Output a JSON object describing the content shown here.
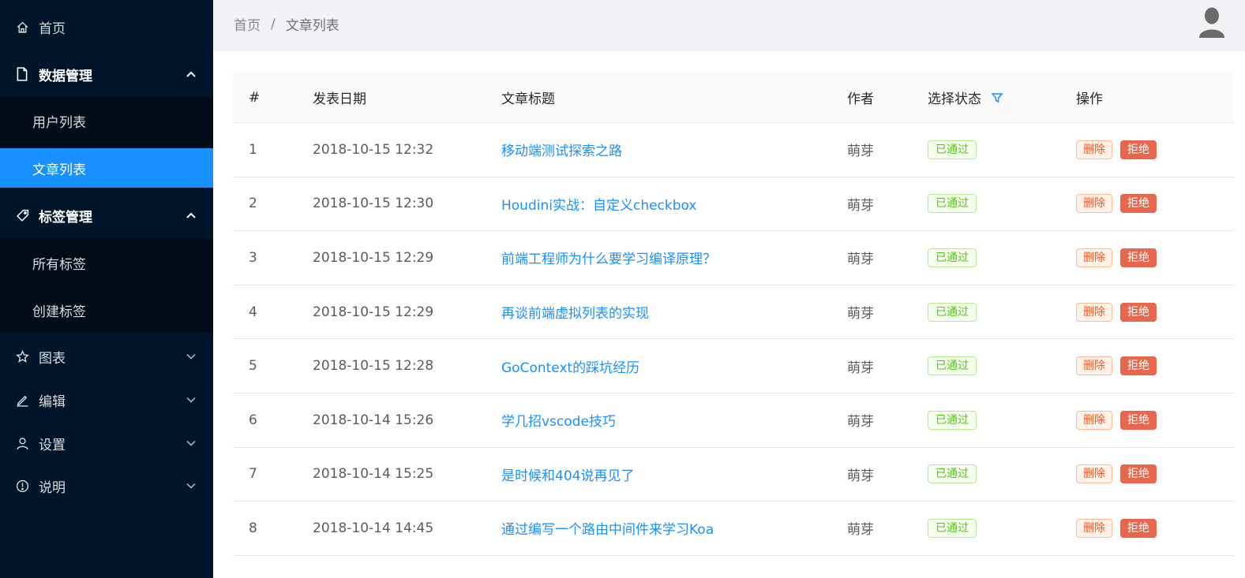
{
  "sidebar": {
    "home": "首页",
    "data_mgmt": "数据管理",
    "data_children": [
      "用户列表",
      "文章列表"
    ],
    "tag_mgmt": "标签管理",
    "tag_children": [
      "所有标签",
      "创建标签"
    ],
    "charts": "图表",
    "edit": "编辑",
    "settings": "设置",
    "about": "说明",
    "active_item": "文章列表"
  },
  "breadcrumb": {
    "home": "首页",
    "separator": "/",
    "current": "文章列表"
  },
  "table": {
    "columns": [
      "#",
      "发表日期",
      "文章标题",
      "作者",
      "选择状态",
      "操作"
    ],
    "rows": [
      {
        "id": "1",
        "date": "2018-10-15 12:32",
        "title": "移动端测试探索之路",
        "author": "萌芽",
        "status": "已通过",
        "del": "删除",
        "reject": "拒绝"
      },
      {
        "id": "2",
        "date": "2018-10-15 12:30",
        "title": "Houdini实战：自定义checkbox",
        "author": "萌芽",
        "status": "已通过",
        "del": "删除",
        "reject": "拒绝"
      },
      {
        "id": "3",
        "date": "2018-10-15 12:29",
        "title": "前端工程师为什么要学习编译原理？",
        "author": "萌芽",
        "status": "已通过",
        "del": "删除",
        "reject": "拒绝"
      },
      {
        "id": "4",
        "date": "2018-10-15 12:29",
        "title": "再谈前端虚拟列表的实现",
        "author": "萌芽",
        "status": "已通过",
        "del": "删除",
        "reject": "拒绝"
      },
      {
        "id": "5",
        "date": "2018-10-15 12:28",
        "title": "GoContext的踩坑经历",
        "author": "萌芽",
        "status": "已通过",
        "del": "删除",
        "reject": "拒绝"
      },
      {
        "id": "6",
        "date": "2018-10-14 15:26",
        "title": "学几招vscode技巧",
        "author": "萌芽",
        "status": "已通过",
        "del": "删除",
        "reject": "拒绝"
      },
      {
        "id": "7",
        "date": "2018-10-14 15:25",
        "title": "是时候和404说再见了",
        "author": "萌芽",
        "status": "已通过",
        "del": "删除",
        "reject": "拒绝"
      },
      {
        "id": "8",
        "date": "2018-10-14 14:45",
        "title": "通过编写一个路由中间件来学习Koa",
        "author": "萌芽",
        "status": "已通过",
        "del": "删除",
        "reject": "拒绝"
      }
    ]
  },
  "colors": {
    "sidebar_bg": "#001529",
    "submenu_bg": "#000c17",
    "active": "#1890ff",
    "link": "#1890ff",
    "tag_green": "#52c41a",
    "delete": "#fa541c",
    "reject": "#e8664b"
  },
  "icons": {
    "home": "home-icon",
    "data": "file-icon",
    "tag": "tag-icon",
    "charts": "star-icon",
    "edit": "edit-icon",
    "settings": "user-icon",
    "about": "info-icon",
    "filter": "filter-icon",
    "avatar": "avatar-icon"
  }
}
